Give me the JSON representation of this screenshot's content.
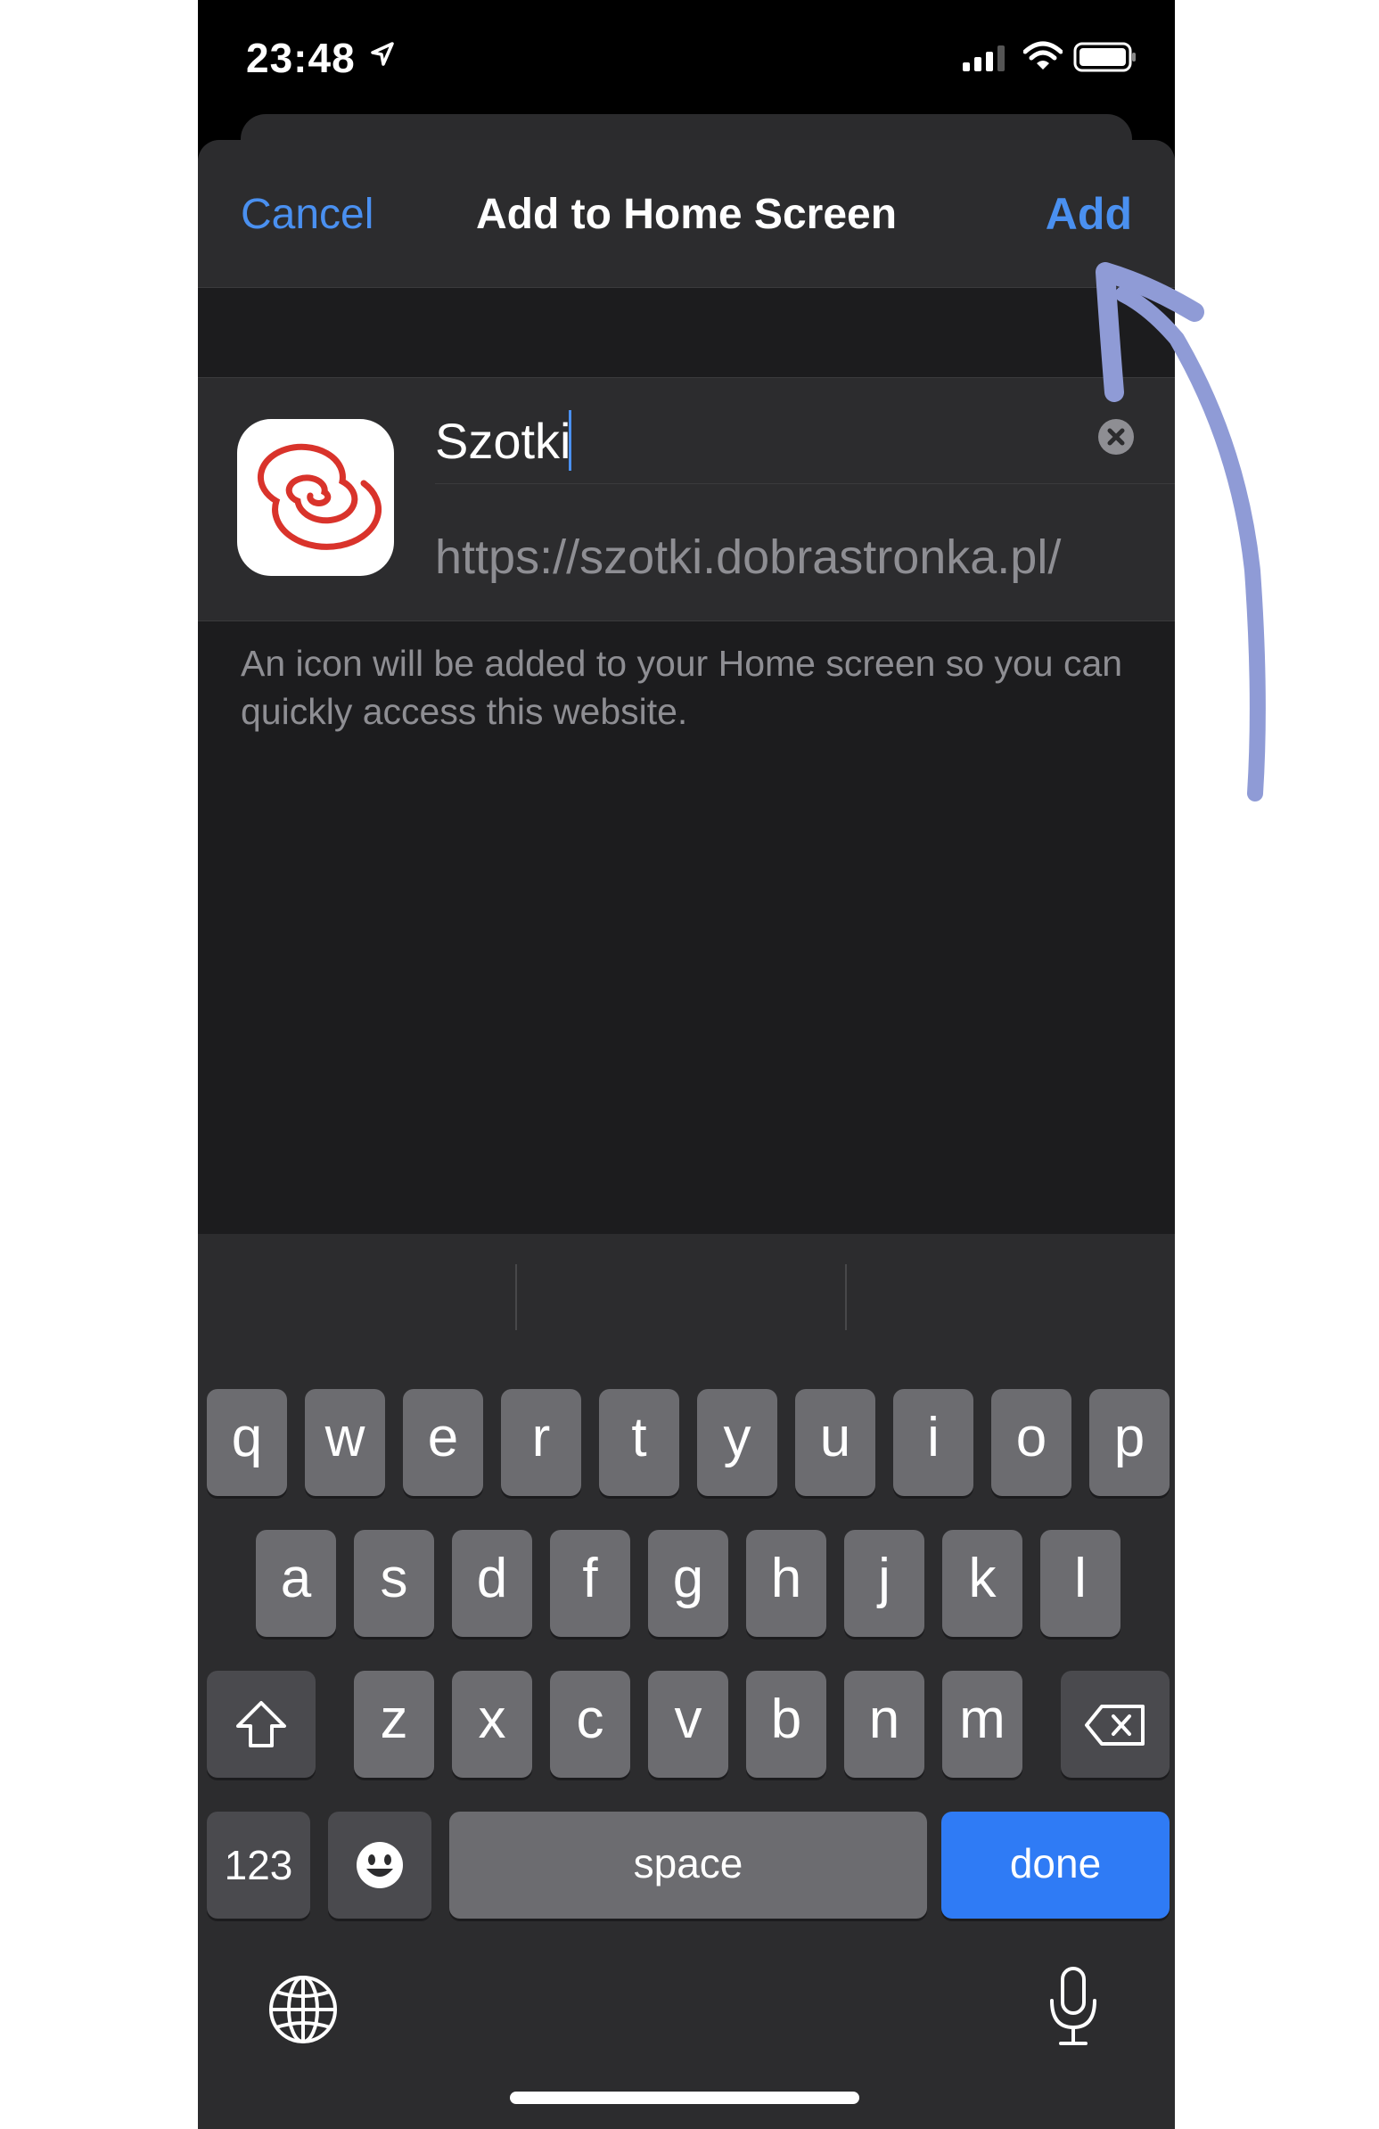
{
  "status_bar": {
    "time": "23:48"
  },
  "nav": {
    "cancel_label": "Cancel",
    "title": "Add to Home Screen",
    "add_label": "Add"
  },
  "bookmark": {
    "name_value": "Szotki",
    "url": "https://szotki.dobrastronka.pl/",
    "icon": "spiral-logo-icon"
  },
  "hint_text": "An icon will be added to your Home screen so you can quickly access this website.",
  "keyboard": {
    "row1": [
      "q",
      "w",
      "e",
      "r",
      "t",
      "y",
      "u",
      "i",
      "o",
      "p"
    ],
    "row2": [
      "a",
      "s",
      "d",
      "f",
      "g",
      "h",
      "j",
      "k",
      "l"
    ],
    "row3": [
      "z",
      "x",
      "c",
      "v",
      "b",
      "n",
      "m"
    ],
    "numbers_label": "123",
    "space_label": "space",
    "done_label": "done"
  },
  "colors": {
    "accent": "#4a90f0",
    "done_key": "#2f7bf5",
    "arrow": "#8f9bd6",
    "logo_red": "#d9332b"
  }
}
